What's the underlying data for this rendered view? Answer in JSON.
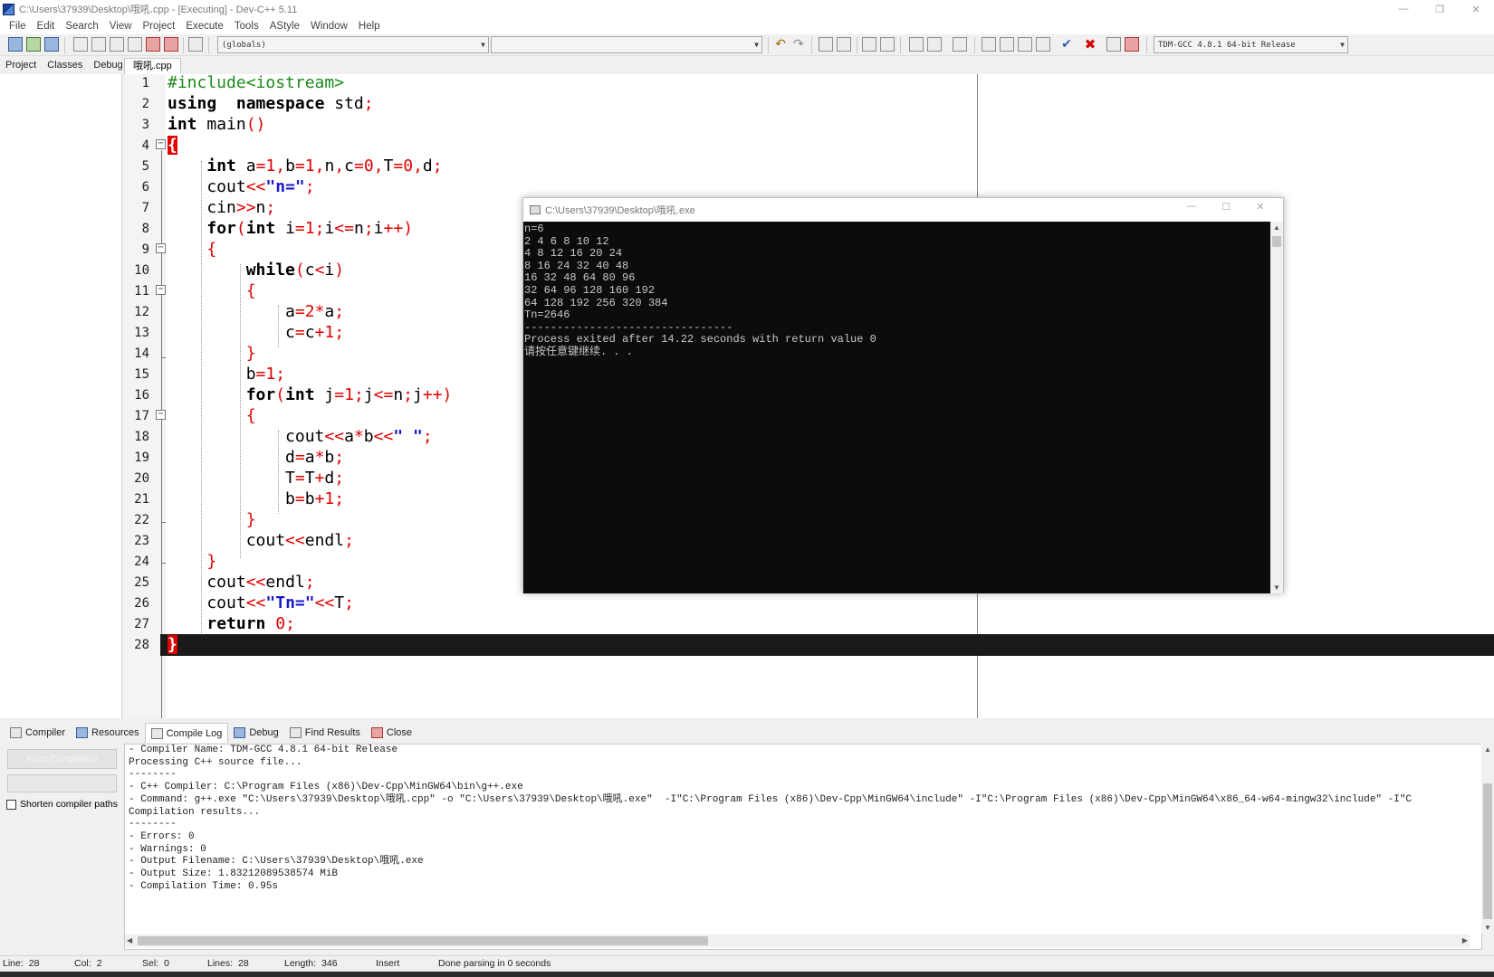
{
  "window": {
    "title": "C:\\Users\\37939\\Desktop\\哦吼.cpp - [Executing] - Dev-C++ 5.11",
    "controls": [
      "—",
      "❐",
      "✕"
    ]
  },
  "menu": [
    "File",
    "Edit",
    "Search",
    "View",
    "Project",
    "Execute",
    "Tools",
    "AStyle",
    "Window",
    "Help"
  ],
  "toolbar": {
    "scope_combo": "(globals)",
    "member_combo": "",
    "compiler_combo": "TDM-GCC 4.8.1 64-bit Release"
  },
  "left_tabs": [
    "Project",
    "Classes",
    "Debug"
  ],
  "editor": {
    "file_tab": "哦吼.cpp",
    "line_numbers": [
      "1",
      "2",
      "3",
      "4",
      "5",
      "6",
      "7",
      "8",
      "9",
      "10",
      "11",
      "12",
      "13",
      "14",
      "15",
      "16",
      "17",
      "18",
      "19",
      "20",
      "21",
      "22",
      "23",
      "24",
      "25",
      "26",
      "27",
      "28"
    ],
    "current_line": 28
  },
  "console": {
    "title": "C:\\Users\\37939\\Desktop\\哦吼.exe",
    "lines": [
      "n=6",
      "2 4 6 8 10 12",
      "4 8 12 16 20 24",
      "8 16 24 32 40 48",
      "16 32 48 64 80 96",
      "32 64 96 128 160 192",
      "64 128 192 256 320 384",
      "",
      "Tn=2646",
      "--------------------------------",
      "Process exited after 14.22 seconds with return value 0",
      "请按任意键继续. . ."
    ]
  },
  "bottom_tabs": [
    "Compiler",
    "Resources",
    "Compile Log",
    "Debug",
    "Find Results",
    "Close"
  ],
  "bottom_left": {
    "abort_label": "Abort Compilation",
    "shorten_label": "Shorten compiler paths"
  },
  "compile_log": [
    "- Compiler Name: TDM-GCC 4.8.1 64-bit Release",
    "",
    "Processing C++ source file...",
    "--------",
    "- C++ Compiler: C:\\Program Files (x86)\\Dev-Cpp\\MinGW64\\bin\\g++.exe",
    "- Command: g++.exe \"C:\\Users\\37939\\Desktop\\哦吼.cpp\" -o \"C:\\Users\\37939\\Desktop\\哦吼.exe\"  -I\"C:\\Program Files (x86)\\Dev-Cpp\\MinGW64\\include\" -I\"C:\\Program Files (x86)\\Dev-Cpp\\MinGW64\\x86_64-w64-mingw32\\include\" -I\"C",
    "",
    "Compilation results...",
    "--------",
    "- Errors: 0",
    "- Warnings: 0",
    "- Output Filename: C:\\Users\\37939\\Desktop\\哦吼.exe",
    "- Output Size: 1.83212089538574 MiB",
    "- Compilation Time: 0.95s"
  ],
  "status": {
    "line_label": "Line:",
    "line_value": "28",
    "col_label": "Col:",
    "col_value": "2",
    "sel_label": "Sel:",
    "sel_value": "0",
    "lines_label": "Lines:",
    "lines_value": "28",
    "length_label": "Length:",
    "length_value": "346",
    "mode": "Insert",
    "message": "Done parsing in 0 seconds"
  }
}
